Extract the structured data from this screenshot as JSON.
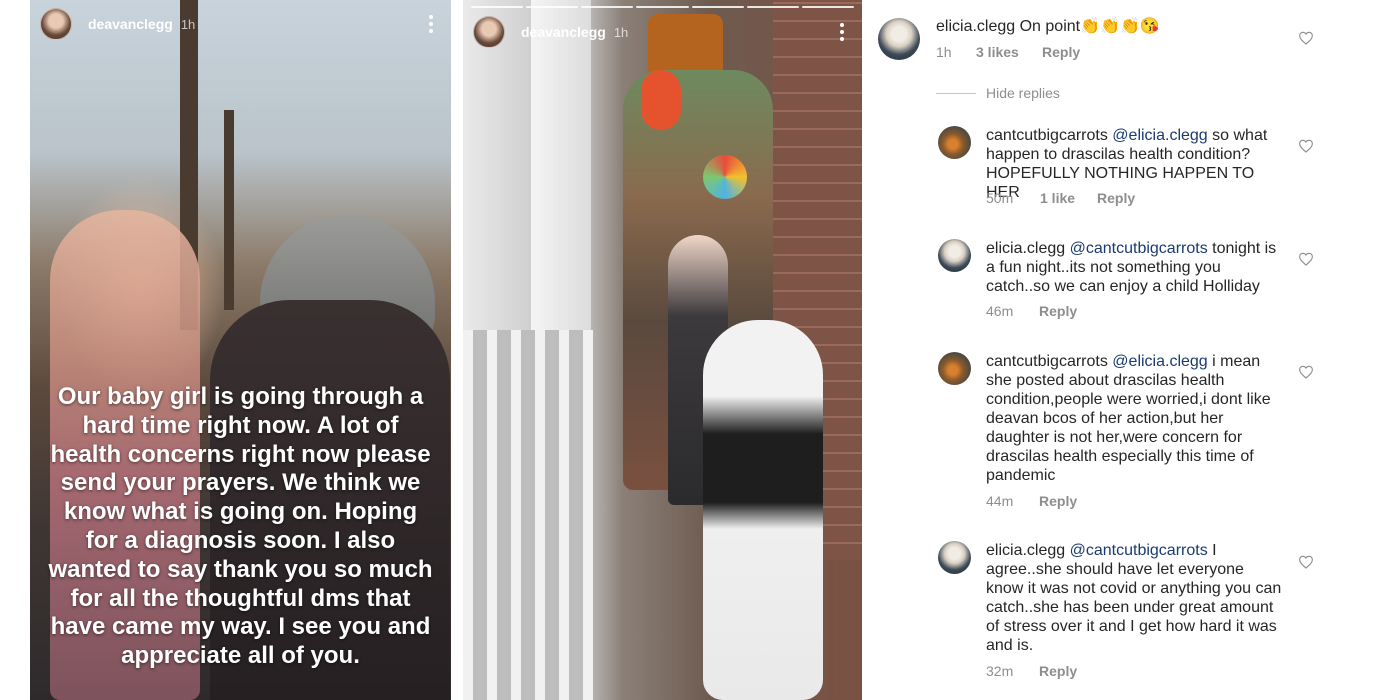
{
  "stories": [
    {
      "username": "deavanclegg",
      "time": "1h",
      "caption": "Our baby girl is going through a hard time right now. A lot of health concerns right now please send your prayers. We think we know what is going on. Hoping for a diagnosis soon. I also wanted to say thank you so much for all the thoughtful dms that have came my way. I see you and appreciate all of you."
    },
    {
      "username": "deavanclegg",
      "time": "1h"
    }
  ],
  "comments": {
    "top": {
      "username": "elicia.clegg",
      "text": "On point👏👏👏😘",
      "time": "1h",
      "likes": "3 likes",
      "reply": "Reply"
    },
    "hide_replies": "Hide replies",
    "replies": [
      {
        "username": "cantcutbigcarrots",
        "mention": "@elicia.clegg",
        "text": "so what happen to drascilas health condition? HOPEFULLY NOTHING HAPPEN TO HER",
        "time": "50m",
        "likes": "1 like",
        "reply": "Reply"
      },
      {
        "username": "elicia.clegg",
        "mention": "@cantcutbigcarrots",
        "text": "tonight is a fun night..its not something you catch..so we can enjoy a child Holliday",
        "time": "46m",
        "reply": "Reply"
      },
      {
        "username": "cantcutbigcarrots",
        "mention": "@elicia.clegg",
        "text": "i mean she posted about drascilas health condition,people were worried,i dont like deavan bcos of her action,but her daughter is not her,were concern for drascilas health especially  this time of pandemic",
        "time": "44m",
        "reply": "Reply"
      },
      {
        "username": "elicia.clegg",
        "mention": "@cantcutbigcarrots",
        "text": "I agree..she should have let everyone know it was not covid or anything you can catch..she has been under great amount of stress over it and I get how hard it was and is.",
        "time": "32m",
        "reply": "Reply"
      }
    ]
  }
}
